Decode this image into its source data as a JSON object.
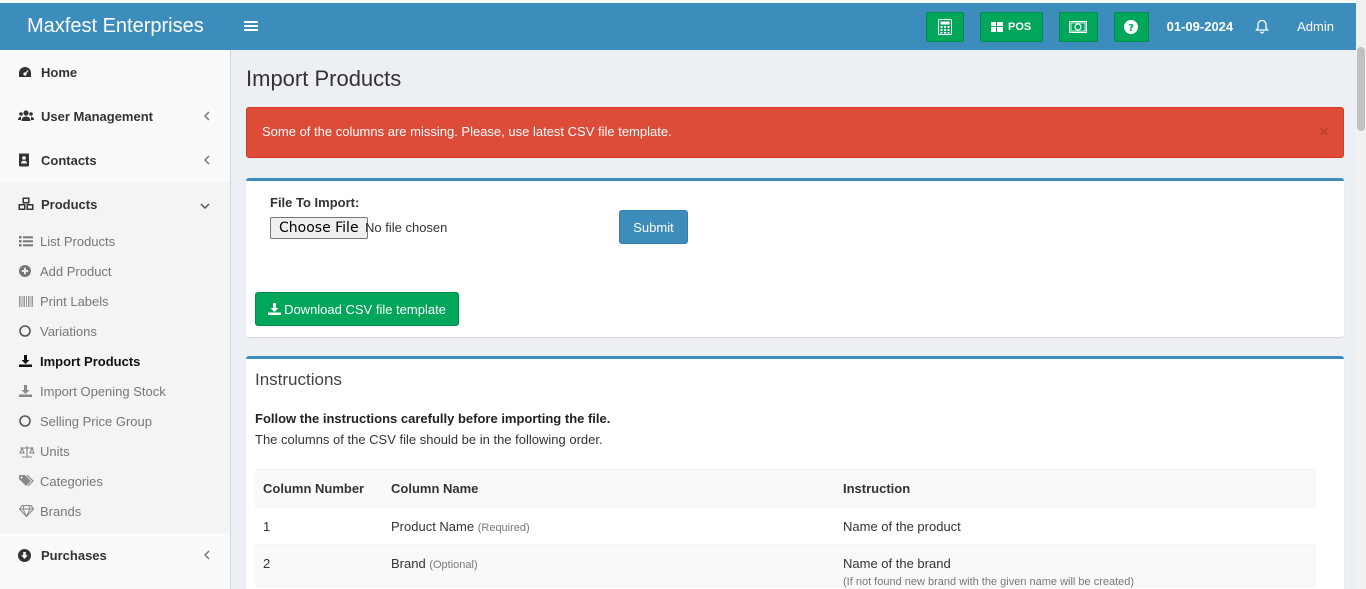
{
  "header": {
    "brand": "Maxfest Enterprises",
    "pos_label": "POS",
    "date": "01-09-2024",
    "user": "Admin"
  },
  "colors": {
    "primary": "#3c8dbc",
    "success": "#00a65a",
    "danger": "#dd4b39"
  },
  "sidebar": {
    "items": [
      {
        "label": "Home",
        "icon": "dashboard-icon"
      },
      {
        "label": "User Management",
        "icon": "users-icon"
      },
      {
        "label": "Contacts",
        "icon": "address-book-icon"
      },
      {
        "label": "Products",
        "icon": "cubes-icon"
      }
    ],
    "products_sub": [
      {
        "label": "List Products",
        "icon": "list-icon"
      },
      {
        "label": "Add Product",
        "icon": "plus-circle-icon"
      },
      {
        "label": "Print Labels",
        "icon": "barcode-icon"
      },
      {
        "label": "Variations",
        "icon": "circle-icon"
      },
      {
        "label": "Import Products",
        "icon": "download-icon"
      },
      {
        "label": "Import Opening Stock",
        "icon": "download-icon"
      },
      {
        "label": "Selling Price Group",
        "icon": "circle-icon"
      },
      {
        "label": "Units",
        "icon": "balance-scale-icon"
      },
      {
        "label": "Categories",
        "icon": "tags-icon"
      },
      {
        "label": "Brands",
        "icon": "gem-icon"
      }
    ],
    "purchases": {
      "label": "Purchases",
      "icon": "arrow-circle-down-icon"
    }
  },
  "page": {
    "title": "Import Products",
    "alert": "Some of the columns are missing. Please, use latest CSV file template.",
    "alert_close": "×"
  },
  "import_form": {
    "file_label": "File To Import:",
    "choose_file": "Choose File",
    "no_file": "No file chosen",
    "submit": "Submit",
    "download": "Download CSV file template"
  },
  "instructions": {
    "title": "Instructions",
    "strong": "Follow the instructions carefully before importing the file.",
    "sub": "The columns of the CSV file should be in the following order.",
    "headers": [
      "Column Number",
      "Column Name",
      "Instruction"
    ],
    "rows": [
      {
        "num": "1",
        "name": "Product Name",
        "tag": "(Required)",
        "instruction": "Name of the product",
        "note": ""
      },
      {
        "num": "2",
        "name": "Brand",
        "tag": "(Optional)",
        "instruction": "Name of the brand",
        "note": "(If not found new brand with the given name will be created)"
      }
    ]
  }
}
